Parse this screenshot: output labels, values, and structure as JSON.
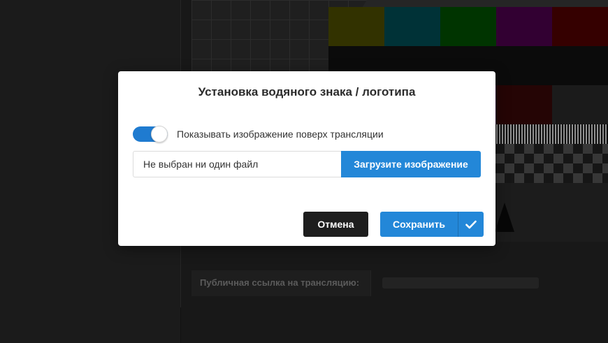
{
  "background": {
    "public_link_label": "Публичная ссылка на трансляцию:",
    "test_pattern_colors": [
      "#4d4d00",
      "#004d55",
      "#005100",
      "#4d004d",
      "#520000"
    ],
    "test_pattern_colors_row2": [
      "#0a0a0a",
      "#0a3d0a",
      "#3d0a3d",
      "#3a0808",
      "#2a2a2a"
    ]
  },
  "modal": {
    "title": "Установка водяного знака / логотипа",
    "toggle": {
      "label": "Показывать изображение поверх трансляции",
      "checked": true,
      "accent": "#1f7bd0"
    },
    "file": {
      "status_text": "Не выбран ни один файл",
      "upload_label": "Загрузите изображение"
    },
    "actions": {
      "cancel_label": "Отмена",
      "save_label": "Сохранить",
      "save_icon": "checkmark-icon"
    }
  },
  "colors": {
    "primary": "#2387d8",
    "dark_button": "#1e1e1e"
  }
}
